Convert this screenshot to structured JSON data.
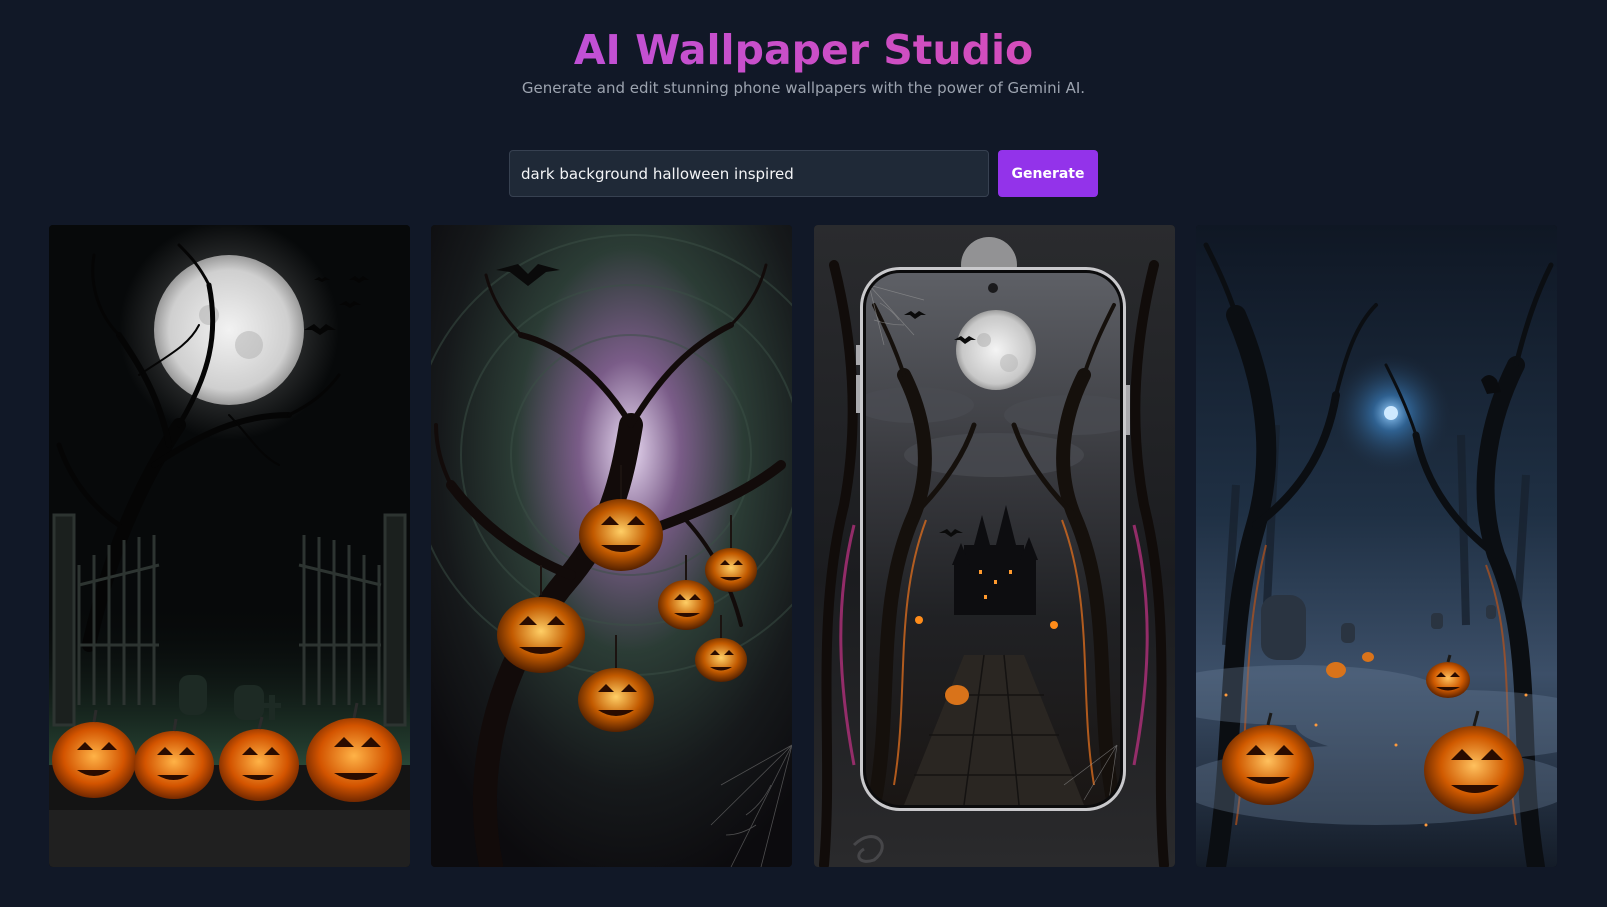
{
  "header": {
    "title": "AI Wallpaper Studio",
    "subtitle": "Generate and edit stunning phone wallpapers with the power of Gemini AI."
  },
  "prompt": {
    "value": "dark background halloween inspired",
    "generate_label": "Generate"
  },
  "colors": {
    "background": "#111827",
    "accent": "#9333ea",
    "title_gradient_start": "#a855f7",
    "title_gradient_end": "#ec4899"
  },
  "wallpapers": [
    {
      "subject": "moonlit-graveyard-pumpkins"
    },
    {
      "subject": "tree-hanging-pumpkins"
    },
    {
      "subject": "phone-mockup-haunted-castle"
    },
    {
      "subject": "foggy-forest-pumpkins"
    }
  ]
}
